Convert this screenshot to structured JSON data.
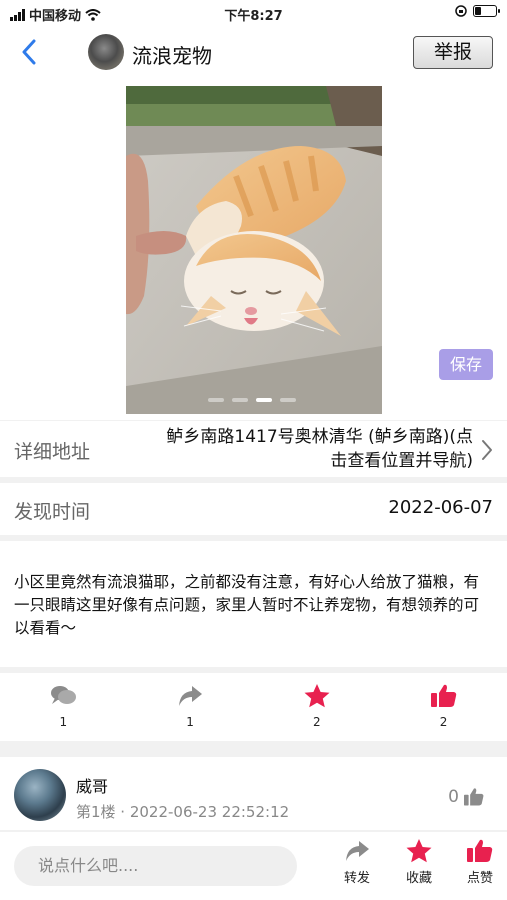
{
  "status_bar": {
    "carrier": "中国移动",
    "time": "下午8:27"
  },
  "header": {
    "title": "流浪宠物",
    "report_label": "举报"
  },
  "photo": {
    "save_label": "保存",
    "page_count": 4,
    "active_page": 3
  },
  "address": {
    "label": "详细地址",
    "value": "鲈乡南路1417号奥林清华 (鲈乡南路)(点击查看位置并导航)"
  },
  "found_time": {
    "label": "发现时间",
    "value": "2022-06-07"
  },
  "description": "小区里竟然有流浪猫耶，之前都没有注意，有好心人给放了猫粮，有一只眼睛这里好像有点问题，家里人暂时不让养宠物，有想领养的可以看看～",
  "actions": [
    {
      "icon": "comment-icon",
      "count": "1"
    },
    {
      "icon": "share-icon",
      "count": "1"
    },
    {
      "icon": "star-icon",
      "count": "2"
    },
    {
      "icon": "thumbs-up-icon",
      "count": "2"
    }
  ],
  "comment": {
    "author": "威哥",
    "meta": "第1楼 · 2022-06-23 22:52:12",
    "like_count": "0"
  },
  "bottom_bar": {
    "input_placeholder": "说点什么吧....",
    "share_label": "转发",
    "favorite_label": "收藏",
    "like_label": "点赞"
  },
  "colors": {
    "accent": "#e8214f",
    "back": "#2f7bea",
    "save_button": "#a99ee7",
    "icon_gray": "#8b8b8b"
  }
}
